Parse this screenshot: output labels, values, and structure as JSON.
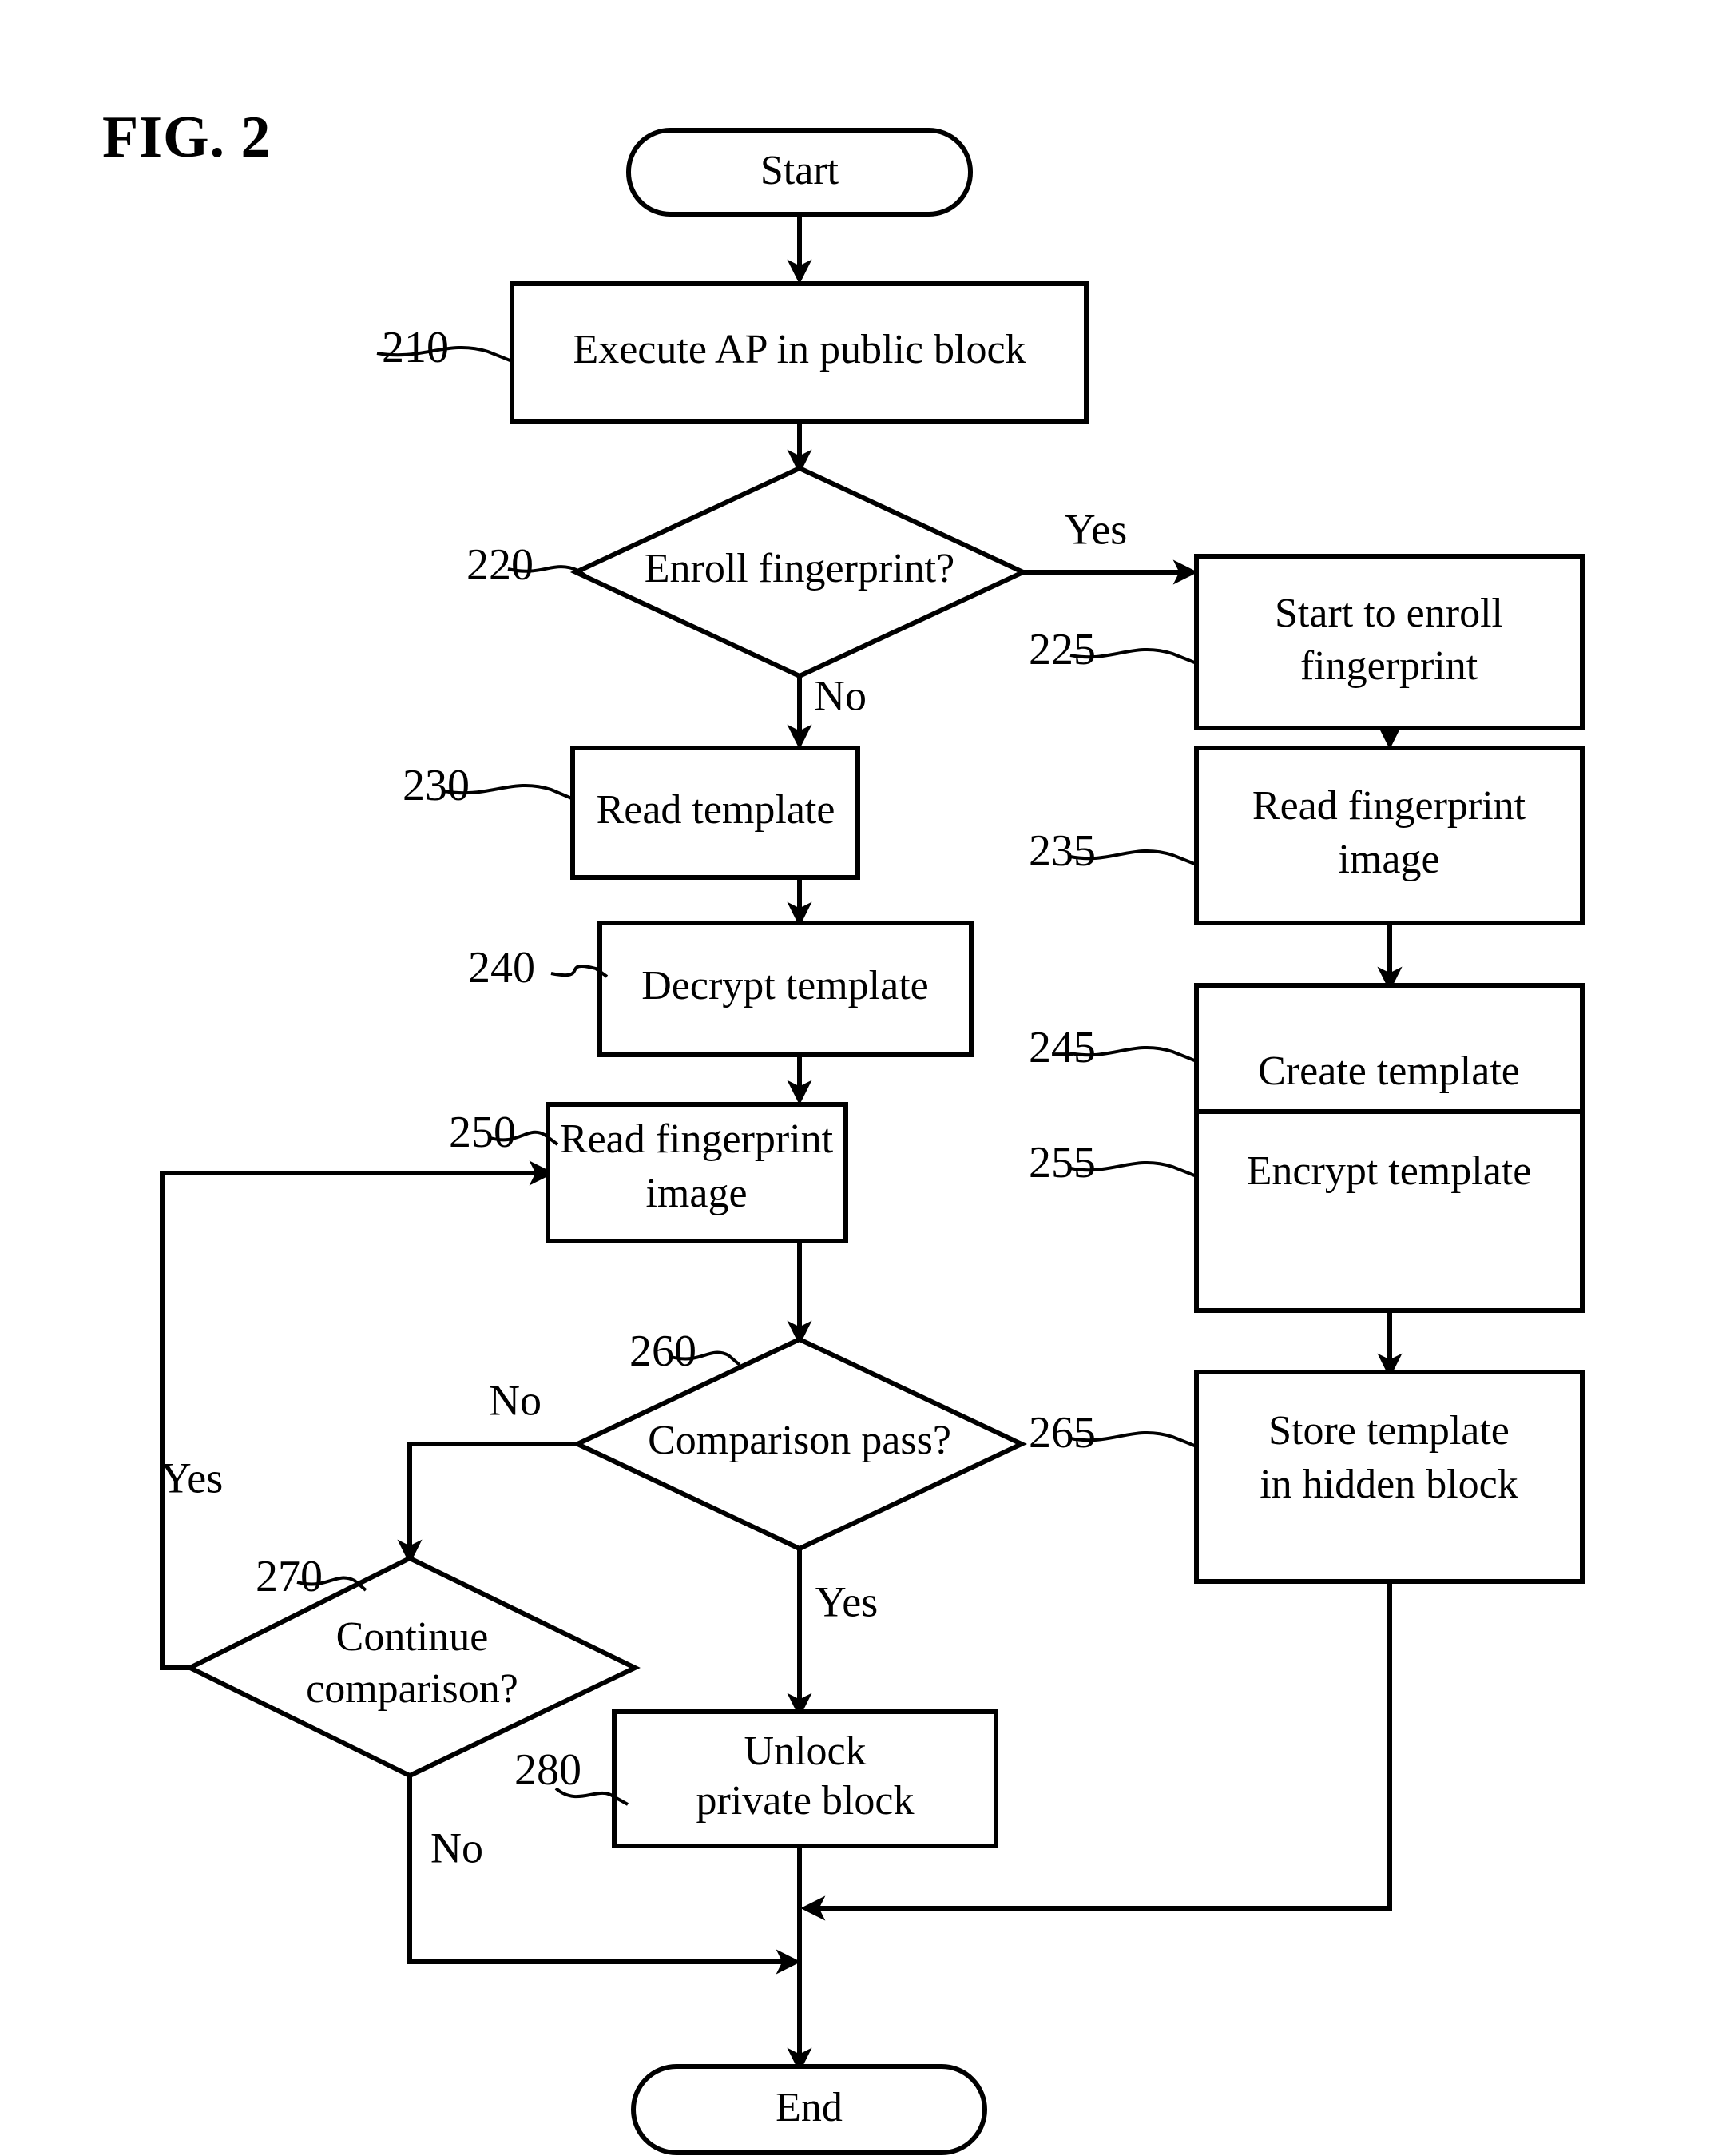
{
  "figure": {
    "title": "FIG. 2",
    "domain": "patent-flowchart"
  },
  "nodes": [
    {
      "id": "start",
      "ref": "",
      "type": "terminator",
      "lines": [
        "Start"
      ]
    },
    {
      "id": "n210",
      "ref": "210",
      "type": "process",
      "lines": [
        "Execute AP in public block"
      ]
    },
    {
      "id": "n220",
      "ref": "220",
      "type": "decision",
      "lines": [
        "Enroll fingerprint?"
      ]
    },
    {
      "id": "n225",
      "ref": "225",
      "type": "process",
      "lines": [
        "Start to enroll",
        "fingerprint"
      ]
    },
    {
      "id": "n230",
      "ref": "230",
      "type": "process",
      "lines": [
        "Read template"
      ]
    },
    {
      "id": "n235",
      "ref": "235",
      "type": "process",
      "lines": [
        "Read fingerprint",
        "image"
      ]
    },
    {
      "id": "n240",
      "ref": "240",
      "type": "process",
      "lines": [
        "Decrypt template"
      ]
    },
    {
      "id": "n245",
      "ref": "245",
      "type": "process",
      "lines": [
        "Create template"
      ]
    },
    {
      "id": "n250",
      "ref": "250",
      "type": "process",
      "lines": [
        "Read fingerprint",
        "image"
      ]
    },
    {
      "id": "n255",
      "ref": "255",
      "type": "process",
      "lines": [
        "Encrypt template"
      ]
    },
    {
      "id": "n260",
      "ref": "260",
      "type": "decision",
      "lines": [
        "Comparison pass?"
      ]
    },
    {
      "id": "n265",
      "ref": "265",
      "type": "process",
      "lines": [
        "Store template",
        "in hidden block"
      ]
    },
    {
      "id": "n270",
      "ref": "270",
      "type": "decision",
      "lines": [
        "Continue",
        "comparison?"
      ]
    },
    {
      "id": "n280",
      "ref": "280",
      "type": "process",
      "lines": [
        "Unlock",
        "private block"
      ]
    },
    {
      "id": "end",
      "ref": "",
      "type": "terminator",
      "lines": [
        "End"
      ]
    }
  ],
  "branch_labels": {
    "enroll_yes": "Yes",
    "enroll_no": "No",
    "compare_no": "No",
    "compare_yes": "Yes",
    "continue_yes": "Yes",
    "continue_no": "No"
  },
  "colors": {
    "ink": "#000000",
    "paper": "#ffffff"
  }
}
